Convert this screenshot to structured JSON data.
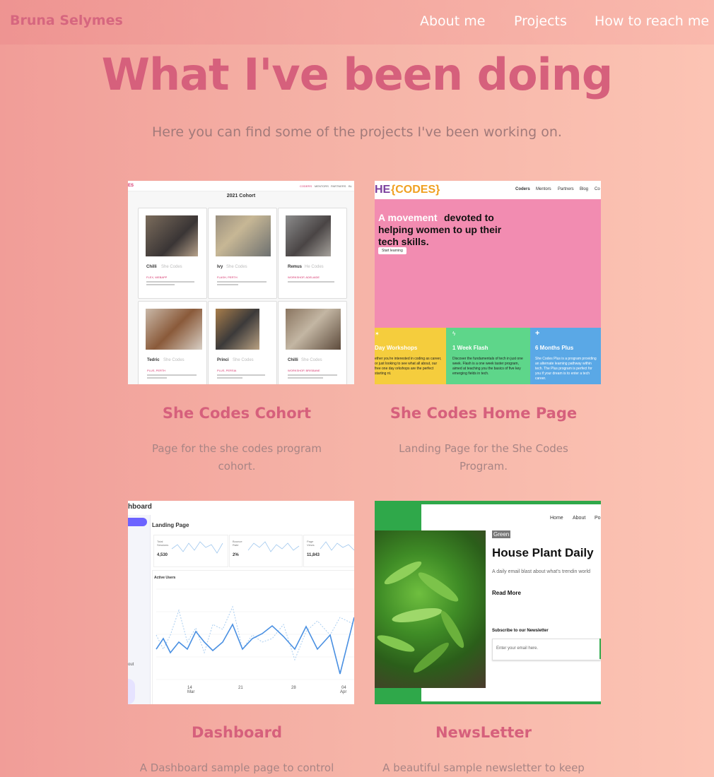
{
  "nav": {
    "brand": "Bruna Selymes",
    "links": [
      "About me",
      "Projects",
      "How to reach me"
    ]
  },
  "header": {
    "title": "What I've been doing",
    "subtitle": "Here you can find some of the projects I've been working on."
  },
  "projects": [
    {
      "title": "She Codes Cohort",
      "desc_l1": "Page for the she codes program",
      "desc_l2": "cohort."
    },
    {
      "title": "She Codes Home Page",
      "desc_l1": "Landing Page for the She Codes",
      "desc_l2": "Program."
    },
    {
      "title": "Dashboard",
      "desc_l1": "A Dashboard sample page to control"
    },
    {
      "title": "NewsLetter",
      "desc_l1": "A beautiful sample newsletter to keep"
    }
  ],
  "shot_cohort": {
    "logo": "ES",
    "menu": [
      "CODERS",
      "MENTORS",
      "PARTNERS",
      "BL"
    ],
    "heading": "2021 Cohort",
    "cards": [
      {
        "name": "Chilli",
        "tag": "She Codes",
        "track": "FLEX, WEBAPP"
      },
      {
        "name": "Ivy",
        "tag": "She Codes",
        "track": "FLASH, PERTH"
      },
      {
        "name": "Remus",
        "tag": "He Codes",
        "track": "WORKSHOP, ADELAIDE"
      },
      {
        "name": "Tedric",
        "tag": "She Codes",
        "track": "PLUS, PERTH"
      },
      {
        "name": "Princi",
        "tag": "She Codes",
        "track": "PLUS, PERSIA"
      },
      {
        "name": "Chilli",
        "tag": "She Codes",
        "track": "WORKSHOP, BRISBANE"
      }
    ]
  },
  "shot_home": {
    "logo_a": "HE",
    "logo_b": "{CODES}",
    "menu": [
      "Coders",
      "Mentors",
      "Partners",
      "Blog",
      "Co"
    ],
    "hero_highlight": "A movement",
    "hero_rest_1": "devoted to",
    "hero_line_2": "helping women to up their",
    "hero_line_3": "tech skills.",
    "cta": "Start learning",
    "cols": [
      {
        "title": "Day Workshops",
        "body": "ether you're interested in coding as career, or just looking to see what all about, our free one day orkshops are the perfect starting nt."
      },
      {
        "title": "1 Week Flash",
        "body": "Discover the fundamentals of tech in just one week. Flash is a one week taster program, aimed at teaching you the basics of five key emerging fields in tech."
      },
      {
        "title": "6 Months Plus",
        "body": "She Codes Plus is a program providing an alternate learning pathway within tech. The Plus program is perfect for you if your dream is to enter a tech career."
      }
    ]
  },
  "shot_dash": {
    "title": "hboard",
    "page": "Landing Page",
    "stats": [
      {
        "label": "Total Sessions",
        "value": "4,530"
      },
      {
        "label": "Bounce Rate",
        "value": "2%"
      },
      {
        "label": "Page Views",
        "value": "11,843"
      }
    ],
    "chart_title": "Active Users",
    "side_label": "out",
    "ticks": [
      {
        "day": "14",
        "month": "Mar"
      },
      {
        "day": "21",
        "month": ""
      },
      {
        "day": "28",
        "month": ""
      },
      {
        "day": "04",
        "month": "Apr"
      }
    ]
  },
  "shot_news": {
    "menu": [
      "Home",
      "About",
      "Po"
    ],
    "badge": "Green",
    "headline": "House Plant Daily",
    "blurb": "A daily email blast about what's trendin world",
    "read_more": "Read More",
    "subscribe": "Subscribe to our Newsletter",
    "email_placeholder": "Enter your email here."
  },
  "colors": {
    "accent": "#d6607c",
    "brand": "#d6667f",
    "sc_pink": "#f28cb1",
    "sc_yellow": "#f5cd3d",
    "sc_green": "#5ed68a",
    "sc_blue": "#5aa8e6",
    "news_green": "#2fa84a"
  }
}
